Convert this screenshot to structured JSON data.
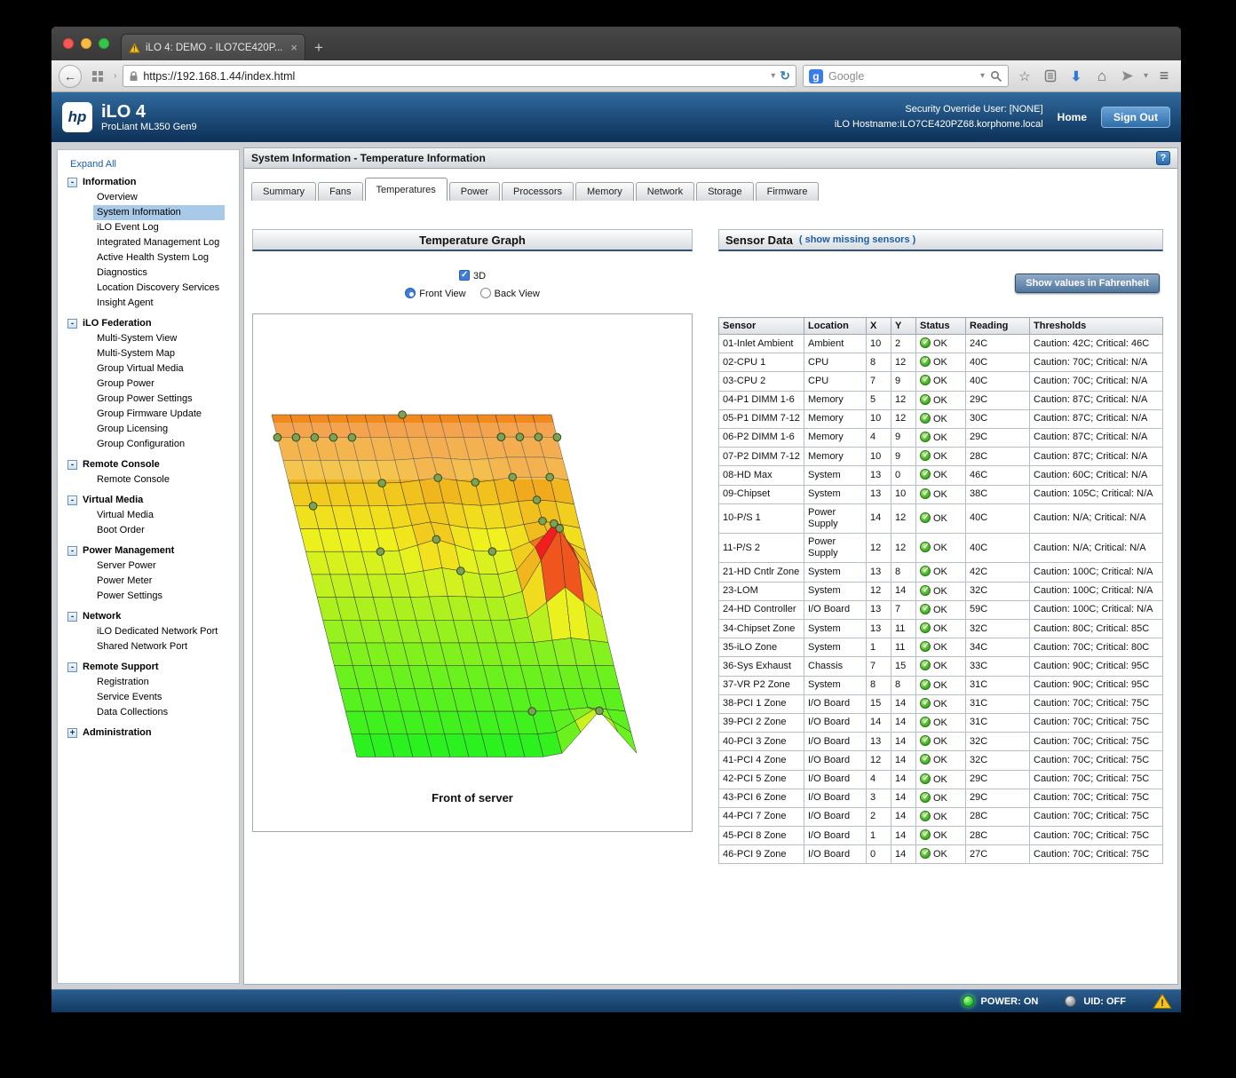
{
  "icons": {
    "back_arrow": "←",
    "page_chevron": "›",
    "url_dropdown": "▾",
    "reload": "↻",
    "search_dropdown": "▾",
    "star": "☆",
    "download_arrow": "⬇",
    "home": "⌂",
    "menu": "≡",
    "google_logo_letter": "g",
    "warning_mark": "!",
    "toggle_expanded": "-",
    "toggle_collapsed": "+"
  },
  "browser": {
    "tab_title": "iLO 4: DEMO - ILO7CE420P...",
    "tab_close": "×",
    "new_tab_button": "+",
    "url": "https://192.168.1.44/index.html",
    "search_engine_label": "Google"
  },
  "app_header": {
    "logo_text": "hp",
    "product_name": "iLO 4",
    "server_model": "ProLiant ML350 Gen9",
    "security_override": "Security Override User: [NONE]",
    "hostname": "iLO Hostname:ILO7CE420PZ68.korphome.local",
    "home_link": "Home",
    "sign_out_button": "Sign Out"
  },
  "sidebar": {
    "expand_all": "Expand All",
    "sections": [
      {
        "label": "Information",
        "expanded": true,
        "selected_item": "System Information",
        "items": [
          "Overview",
          "System Information",
          "iLO Event Log",
          "Integrated Management Log",
          "Active Health System Log",
          "Diagnostics",
          "Location Discovery Services",
          "Insight Agent"
        ]
      },
      {
        "label": "iLO Federation",
        "expanded": true,
        "items": [
          "Multi-System View",
          "Multi-System Map",
          "Group Virtual Media",
          "Group Power",
          "Group Power Settings",
          "Group Firmware Update",
          "Group Licensing",
          "Group Configuration"
        ]
      },
      {
        "label": "Remote Console",
        "expanded": true,
        "items": [
          "Remote Console"
        ]
      },
      {
        "label": "Virtual Media",
        "expanded": true,
        "items": [
          "Virtual Media",
          "Boot Order"
        ]
      },
      {
        "label": "Power Management",
        "expanded": true,
        "items": [
          "Server Power",
          "Power Meter",
          "Power Settings"
        ]
      },
      {
        "label": "Network",
        "expanded": true,
        "items": [
          "iLO Dedicated Network Port",
          "Shared Network Port"
        ]
      },
      {
        "label": "Remote Support",
        "expanded": true,
        "items": [
          "Registration",
          "Service Events",
          "Data Collections"
        ]
      },
      {
        "label": "Administration",
        "expanded": false,
        "items": []
      }
    ]
  },
  "main": {
    "page_title": "System Information - Temperature Information",
    "help_button": "?",
    "tabs": [
      "Summary",
      "Fans",
      "Temperatures",
      "Power",
      "Processors",
      "Memory",
      "Network",
      "Storage",
      "Firmware"
    ],
    "active_tab": "Temperatures"
  },
  "graph_panel": {
    "title": "Temperature Graph",
    "checkbox_3d_label": "3D",
    "front_view_label": "Front View",
    "back_view_label": "Back View",
    "selected_view": "Front View",
    "caption": "Front of server"
  },
  "sensor_panel": {
    "title": "Sensor Data",
    "missing_sensors_link": "( show missing sensors )",
    "fahrenheit_button": "Show values in Fahrenheit",
    "columns": [
      "Sensor",
      "Location",
      "X",
      "Y",
      "Status",
      "Reading",
      "Thresholds"
    ],
    "rows": [
      {
        "sensor": "01-Inlet Ambient",
        "location": "Ambient",
        "x": "10",
        "y": "2",
        "status": "OK",
        "reading": "24C",
        "thresholds": "Caution: 42C; Critical: 46C"
      },
      {
        "sensor": "02-CPU 1",
        "location": "CPU",
        "x": "8",
        "y": "12",
        "status": "OK",
        "reading": "40C",
        "thresholds": "Caution: 70C; Critical: N/A"
      },
      {
        "sensor": "03-CPU 2",
        "location": "CPU",
        "x": "7",
        "y": "9",
        "status": "OK",
        "reading": "40C",
        "thresholds": "Caution: 70C; Critical: N/A"
      },
      {
        "sensor": "04-P1 DIMM 1-6",
        "location": "Memory",
        "x": "5",
        "y": "12",
        "status": "OK",
        "reading": "29C",
        "thresholds": "Caution: 87C; Critical: N/A"
      },
      {
        "sensor": "05-P1 DIMM 7-12",
        "location": "Memory",
        "x": "10",
        "y": "12",
        "status": "OK",
        "reading": "30C",
        "thresholds": "Caution: 87C; Critical: N/A"
      },
      {
        "sensor": "06-P2 DIMM 1-6",
        "location": "Memory",
        "x": "4",
        "y": "9",
        "status": "OK",
        "reading": "29C",
        "thresholds": "Caution: 87C; Critical: N/A"
      },
      {
        "sensor": "07-P2 DIMM 7-12",
        "location": "Memory",
        "x": "10",
        "y": "9",
        "status": "OK",
        "reading": "28C",
        "thresholds": "Caution: 87C; Critical: N/A"
      },
      {
        "sensor": "08-HD Max",
        "location": "System",
        "x": "13",
        "y": "0",
        "status": "OK",
        "reading": "46C",
        "thresholds": "Caution: 60C; Critical: N/A"
      },
      {
        "sensor": "09-Chipset",
        "location": "System",
        "x": "13",
        "y": "10",
        "status": "OK",
        "reading": "38C",
        "thresholds": "Caution: 105C; Critical: N/A"
      },
      {
        "sensor": "10-P/S 1",
        "location": "Power Supply",
        "x": "14",
        "y": "12",
        "status": "OK",
        "reading": "40C",
        "thresholds": "Caution: N/A; Critical: N/A"
      },
      {
        "sensor": "11-P/S 2",
        "location": "Power Supply",
        "x": "12",
        "y": "12",
        "status": "OK",
        "reading": "40C",
        "thresholds": "Caution: N/A; Critical: N/A"
      },
      {
        "sensor": "21-HD Cntlr Zone",
        "location": "System",
        "x": "13",
        "y": "8",
        "status": "OK",
        "reading": "42C",
        "thresholds": "Caution: 100C; Critical: N/A"
      },
      {
        "sensor": "23-LOM",
        "location": "System",
        "x": "12",
        "y": "14",
        "status": "OK",
        "reading": "32C",
        "thresholds": "Caution: 100C; Critical: N/A"
      },
      {
        "sensor": "24-HD Controller",
        "location": "I/O Board",
        "x": "13",
        "y": "7",
        "status": "OK",
        "reading": "59C",
        "thresholds": "Caution: 100C; Critical: N/A"
      },
      {
        "sensor": "34-Chipset Zone",
        "location": "System",
        "x": "13",
        "y": "11",
        "status": "OK",
        "reading": "32C",
        "thresholds": "Caution: 80C; Critical: 85C"
      },
      {
        "sensor": "35-iLO Zone",
        "location": "System",
        "x": "1",
        "y": "11",
        "status": "OK",
        "reading": "34C",
        "thresholds": "Caution: 70C; Critical: 80C"
      },
      {
        "sensor": "36-Sys Exhaust",
        "location": "Chassis",
        "x": "7",
        "y": "15",
        "status": "OK",
        "reading": "33C",
        "thresholds": "Caution: 90C; Critical: 95C"
      },
      {
        "sensor": "37-VR P2 Zone",
        "location": "System",
        "x": "8",
        "y": "8",
        "status": "OK",
        "reading": "31C",
        "thresholds": "Caution: 90C; Critical: 95C"
      },
      {
        "sensor": "38-PCI 1 Zone",
        "location": "I/O Board",
        "x": "15",
        "y": "14",
        "status": "OK",
        "reading": "31C",
        "thresholds": "Caution: 70C; Critical: 75C"
      },
      {
        "sensor": "39-PCI 2 Zone",
        "location": "I/O Board",
        "x": "14",
        "y": "14",
        "status": "OK",
        "reading": "31C",
        "thresholds": "Caution: 70C; Critical: 75C"
      },
      {
        "sensor": "40-PCI 3 Zone",
        "location": "I/O Board",
        "x": "13",
        "y": "14",
        "status": "OK",
        "reading": "32C",
        "thresholds": "Caution: 70C; Critical: 75C"
      },
      {
        "sensor": "41-PCI 4 Zone",
        "location": "I/O Board",
        "x": "12",
        "y": "14",
        "status": "OK",
        "reading": "32C",
        "thresholds": "Caution: 70C; Critical: 75C"
      },
      {
        "sensor": "42-PCI 5 Zone",
        "location": "I/O Board",
        "x": "4",
        "y": "14",
        "status": "OK",
        "reading": "29C",
        "thresholds": "Caution: 70C; Critical: 75C"
      },
      {
        "sensor": "43-PCI 6 Zone",
        "location": "I/O Board",
        "x": "3",
        "y": "14",
        "status": "OK",
        "reading": "29C",
        "thresholds": "Caution: 70C; Critical: 75C"
      },
      {
        "sensor": "44-PCI 7 Zone",
        "location": "I/O Board",
        "x": "2",
        "y": "14",
        "status": "OK",
        "reading": "28C",
        "thresholds": "Caution: 70C; Critical: 75C"
      },
      {
        "sensor": "45-PCI 8 Zone",
        "location": "I/O Board",
        "x": "1",
        "y": "14",
        "status": "OK",
        "reading": "28C",
        "thresholds": "Caution: 70C; Critical: 75C"
      },
      {
        "sensor": "46-PCI 9 Zone",
        "location": "I/O Board",
        "x": "0",
        "y": "14",
        "status": "OK",
        "reading": "27C",
        "thresholds": "Caution: 70C; Critical: 75C"
      }
    ]
  },
  "footer": {
    "power_status": "POWER: ON",
    "uid_status": "UID: OFF"
  }
}
